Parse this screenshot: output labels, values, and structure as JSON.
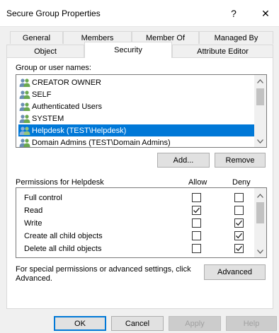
{
  "window": {
    "title": "Secure Group Properties",
    "help_glyph": "?",
    "close_glyph": "✕"
  },
  "tabs_row1": [
    {
      "label": "General"
    },
    {
      "label": "Members"
    },
    {
      "label": "Member Of"
    },
    {
      "label": "Managed By"
    }
  ],
  "tabs_row2": [
    {
      "label": "Object"
    },
    {
      "label": "Security",
      "selected": true
    },
    {
      "label": "Attribute Editor"
    }
  ],
  "users": {
    "label": "Group or user names:",
    "items": [
      {
        "name": "CREATOR OWNER"
      },
      {
        "name": "SELF"
      },
      {
        "name": "Authenticated Users"
      },
      {
        "name": "SYSTEM"
      },
      {
        "name": "Helpdesk (TEST\\Helpdesk)",
        "selected": true
      },
      {
        "name": "Domain Admins (TEST\\Domain Admins)"
      }
    ],
    "add_label": "Add...",
    "remove_label": "Remove"
  },
  "permissions": {
    "title": "Permissions for Helpdesk",
    "allow_header": "Allow",
    "deny_header": "Deny",
    "rows": [
      {
        "name": "Full control",
        "allow": false,
        "deny": false
      },
      {
        "name": "Read",
        "allow": true,
        "deny": false
      },
      {
        "name": "Write",
        "allow": false,
        "deny": true
      },
      {
        "name": "Create all child objects",
        "allow": false,
        "deny": true
      },
      {
        "name": "Delete all child objects",
        "allow": false,
        "deny": true
      }
    ]
  },
  "special": {
    "text_line1": "For special permissions or advanced settings, click",
    "text_line2": "Advanced.",
    "advanced_label": "Advanced"
  },
  "footer": {
    "ok_label": "OK",
    "cancel_label": "Cancel",
    "apply_label": "Apply",
    "help_label": "Help"
  },
  "colors": {
    "selection": "#0078d7",
    "window_bg": "#f0f0f0",
    "panel_bg": "#ffffff"
  }
}
